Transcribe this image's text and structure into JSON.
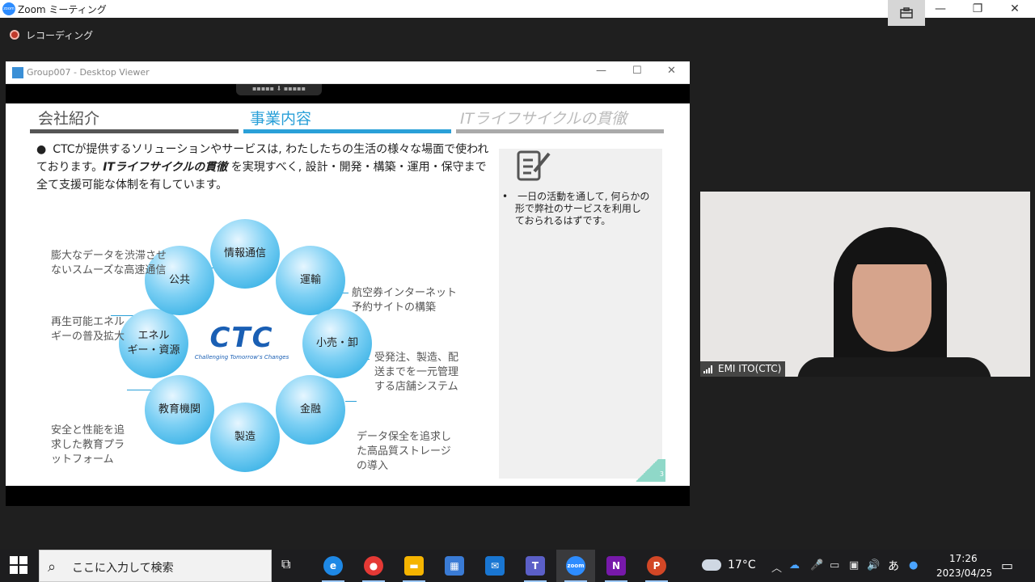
{
  "window": {
    "title": "Zoom ミーティング",
    "recording_label": "レコーディング",
    "logo_text": "zoom"
  },
  "viewer": {
    "title": "Group007 - Desktop Viewer"
  },
  "slide": {
    "tabs": [
      "会社紹介",
      "事業内容",
      "ITライフサイクルの貫徹"
    ],
    "bullet": {
      "part1": "CTCが提供するソリューションやサービスは, わたしたちの生活の様々な場面で使われております。",
      "strong": "ITライフサイクルの貫徹",
      "part2": " を実現すべく, 設計・開発・構築・運用・保守まで全て支援可能な体制を有しています。"
    },
    "circles": [
      "情報通信",
      "運輸",
      "小売・卸",
      "金融",
      "製造",
      "教育機関",
      "エネル\nギー・資源",
      "公共"
    ],
    "logo": "CTC",
    "logo_sub": "Challenging Tomorrow's Changes",
    "notes": {
      "n1": "膨大なデータを渋滞させ\nないスムーズな高速通信",
      "n2": "航空券インターネット\n予約サイトの構築",
      "n3": "再生可能エネル\nギーの普及拡大",
      "n4": "受発注、製造、配\n送までを一元管理\nする店舗システム",
      "n5": "安全と性能を追\n求した教育プラ\nットフォーム",
      "n6": "データ保全を追求し\nた高品質ストレージ\nの導入"
    },
    "side_text": "•　一日の活動を通して, 何らかの\n　 形で弊社のサービスを利用し\n　 ておられるはずです。",
    "page_number": "3"
  },
  "video": {
    "participant_name": "EMI ITO(CTC)"
  },
  "taskbar": {
    "search_placeholder": "ここに入力して検索",
    "weather": "17°C",
    "ime": "あ",
    "time": "17:26",
    "date": "2023/04/25",
    "apps": [
      {
        "name": "edge",
        "color": "#1e88e5",
        "label": "e"
      },
      {
        "name": "chrome",
        "color": "#e53935",
        "label": "●"
      },
      {
        "name": "explorer",
        "color": "#f5b400",
        "label": "▬"
      },
      {
        "name": "store",
        "color": "#3a7bd5",
        "label": "▦"
      },
      {
        "name": "mail",
        "color": "#1976d2",
        "label": "✉"
      },
      {
        "name": "teams",
        "color": "#5b5fc7",
        "label": "T"
      },
      {
        "name": "zoom",
        "color": "#2d8cff",
        "label": "zoom"
      },
      {
        "name": "onenote",
        "color": "#7719aa",
        "label": "N"
      },
      {
        "name": "powerpoint",
        "color": "#d24726",
        "label": "P"
      }
    ]
  },
  "colors": {
    "accent": "#2aa0d8",
    "circle": "#1fa6e0",
    "ctc_blue": "#1a5fb4"
  }
}
